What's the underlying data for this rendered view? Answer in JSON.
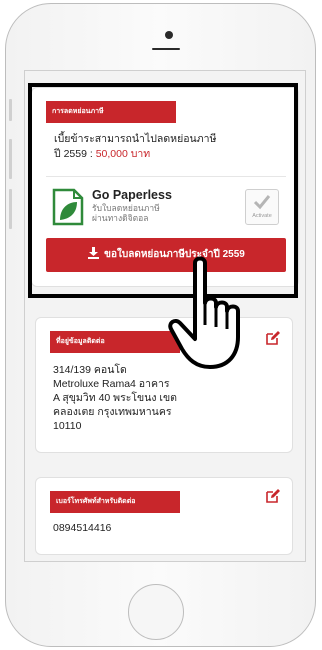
{
  "tax_card": {
    "tag": "การลดหย่อนภาษี",
    "line1": "เบี้ยข้าระสามารถนำไปลดหย่อนภาษี",
    "year_label": "ปี 2559 : ",
    "amount": "50,000 บาท"
  },
  "paperless": {
    "title": "Go Paperless",
    "sub1": "รับใบลดหย่อนภาษี",
    "sub2": "ผ่านทางดิจิตอล",
    "activate": "Activate"
  },
  "request_button": "ขอใบลดหย่อนภาษีประจำปี 2559",
  "address_card": {
    "tag": "ที่อยู่ข้อมูลติดต่อ",
    "lines": [
      "314/139 คอนโด",
      "Metroluxe Rama4 อาคาร",
      "A สุขุมวิท 40 พระโขนง เขต",
      "คลองเตย กรุงเทพมหานคร",
      "10110"
    ]
  },
  "phone_card": {
    "tag": "เบอร์โทรศัพท์สำหรับติดต่อ",
    "number": "0894514416"
  },
  "colors": {
    "accent": "#c8262b",
    "leaf": "#2f8a3a"
  },
  "icons": [
    "document-leaf-icon",
    "check-icon",
    "download-icon",
    "edit-icon",
    "pointing-hand-icon"
  ]
}
